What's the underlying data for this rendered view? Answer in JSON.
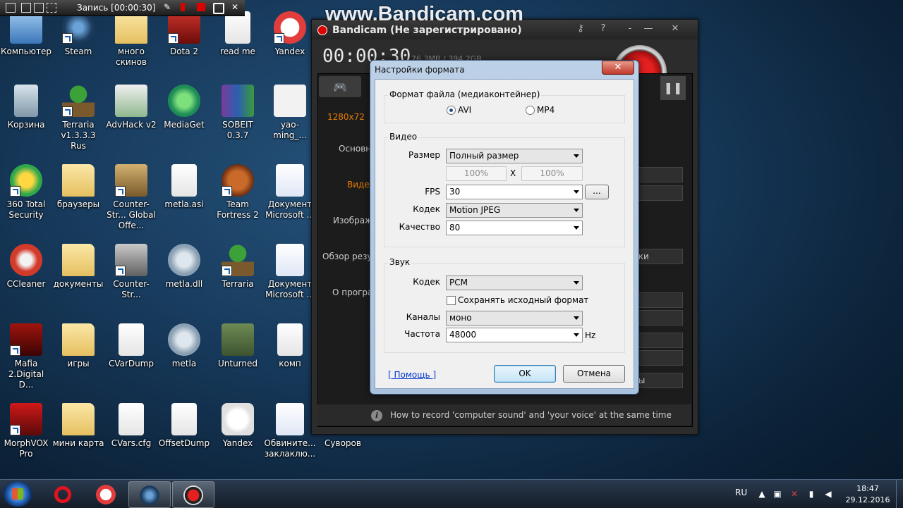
{
  "recorder_bar": {
    "title": "Запись [00:00:30]"
  },
  "watermark": "www.Bandicam.com",
  "desktop_icons": [
    {
      "label": "Компьютер",
      "icon": "computer-icon"
    },
    {
      "label": "Steam",
      "icon": "steam-icon"
    },
    {
      "label": "много скинов",
      "icon": "folder-icon"
    },
    {
      "label": "Dota 2",
      "icon": "dota-icon"
    },
    {
      "label": "read me",
      "icon": "document-icon"
    },
    {
      "label": "Yandex",
      "icon": "yandex-icon"
    },
    {
      "label": "Корзина",
      "icon": "trash-icon"
    },
    {
      "label": "Terraria v1.3.3.3 Rus",
      "icon": "terraria-icon"
    },
    {
      "label": "AdvHack v2",
      "icon": "advhack-icon"
    },
    {
      "label": "MediaGet",
      "icon": "mediaget-icon"
    },
    {
      "label": "SOBEIT 0.3.7",
      "icon": "winrar-icon"
    },
    {
      "label": "yao-ming_...",
      "icon": "image-icon"
    },
    {
      "label": "360 Total Security",
      "icon": "security-icon"
    },
    {
      "label": "браузеры",
      "icon": "folder-icon"
    },
    {
      "label": "Counter-Str... Global Offe...",
      "icon": "csgo-icon"
    },
    {
      "label": "metla.asi",
      "icon": "document-icon"
    },
    {
      "label": "Team Fortress 2",
      "icon": "tf2-icon"
    },
    {
      "label": "Документ Microsoft ...",
      "icon": "word-icon"
    },
    {
      "label": "CCleaner",
      "icon": "ccleaner-icon"
    },
    {
      "label": "документы",
      "icon": "folder-icon"
    },
    {
      "label": "Counter-Str...",
      "icon": "counter-strike-icon"
    },
    {
      "label": "metla.dll",
      "icon": "gear-file-icon"
    },
    {
      "label": "Terraria",
      "icon": "terraria-icon"
    },
    {
      "label": "Документ Microsoft ...",
      "icon": "word-icon"
    },
    {
      "label": "Mafia 2.Digital D...",
      "icon": "mafia-icon"
    },
    {
      "label": "игры",
      "icon": "folder-icon"
    },
    {
      "label": "CVarDump",
      "icon": "document-icon"
    },
    {
      "label": "metla",
      "icon": "gear-file-icon"
    },
    {
      "label": "Unturned",
      "icon": "unturned-icon"
    },
    {
      "label": "комп",
      "icon": "document-icon"
    },
    {
      "label": "MorphVOX Pro",
      "icon": "morphvox-icon"
    },
    {
      "label": "мини карта",
      "icon": "folder-icon"
    },
    {
      "label": "CVars.cfg",
      "icon": "document-icon"
    },
    {
      "label": "OffsetDump",
      "icon": "document-icon"
    },
    {
      "label": "Yandex",
      "icon": "yandex-icon"
    },
    {
      "label": "Обвините... заклаклю...",
      "icon": "word-icon"
    },
    {
      "label": "Суворов",
      "icon": "folder-icon"
    }
  ],
  "bandicam": {
    "title": "Bandicam (Не зарегистрировано)",
    "timer": "00:00:30",
    "size_text": "76.3MB / 394.2GB",
    "resolution": "1280x72",
    "side_menu": [
      "Основн",
      "Видео",
      "Изображ",
      "Обзор резу",
      "О програ"
    ],
    "settings_btn_tail": "йки",
    "bottom_btn_tail": "ны",
    "bottom_tip": "How to record 'computer sound' and 'your voice' at the same time"
  },
  "dialog": {
    "title": "Настройки формата",
    "close_label": "✕",
    "file_format": {
      "group_label": "Формат файла (медиаконтейнер)",
      "options": [
        "AVI",
        "MP4"
      ],
      "selected": "AVI"
    },
    "video": {
      "group_label": "Видео",
      "size_label": "Размер",
      "size_value": "Полный размер",
      "width_pct": "100%",
      "x_sep": "X",
      "height_pct": "100%",
      "fps_label": "FPS",
      "fps_value": "30",
      "more_label": "...",
      "codec_label": "Кодек",
      "codec_value": "Motion JPEG",
      "quality_label": "Качество",
      "quality_value": "80"
    },
    "audio": {
      "group_label": "Звук",
      "codec_label": "Кодек",
      "codec_value": "PCM",
      "keep_format_label": "Сохранять исходный формат",
      "channels_label": "Каналы",
      "channels_value": "моно",
      "rate_label": "Частота",
      "rate_value": "48000",
      "rate_unit": "Hz"
    },
    "help_label": "[ Помощь ]",
    "ok_label": "OK",
    "cancel_label": "Отмена"
  },
  "taskbar": {
    "items": [
      "opera-icon",
      "yandex-browser-icon",
      "steam-icon",
      "bandicam-icon"
    ],
    "language": "RU",
    "time": "18:47",
    "date": "29.12.2016"
  },
  "colors": {
    "bandicam_accent": "#e87a00",
    "dialog_frame": "#a9c2dd",
    "taskbar": "#1c2838"
  }
}
